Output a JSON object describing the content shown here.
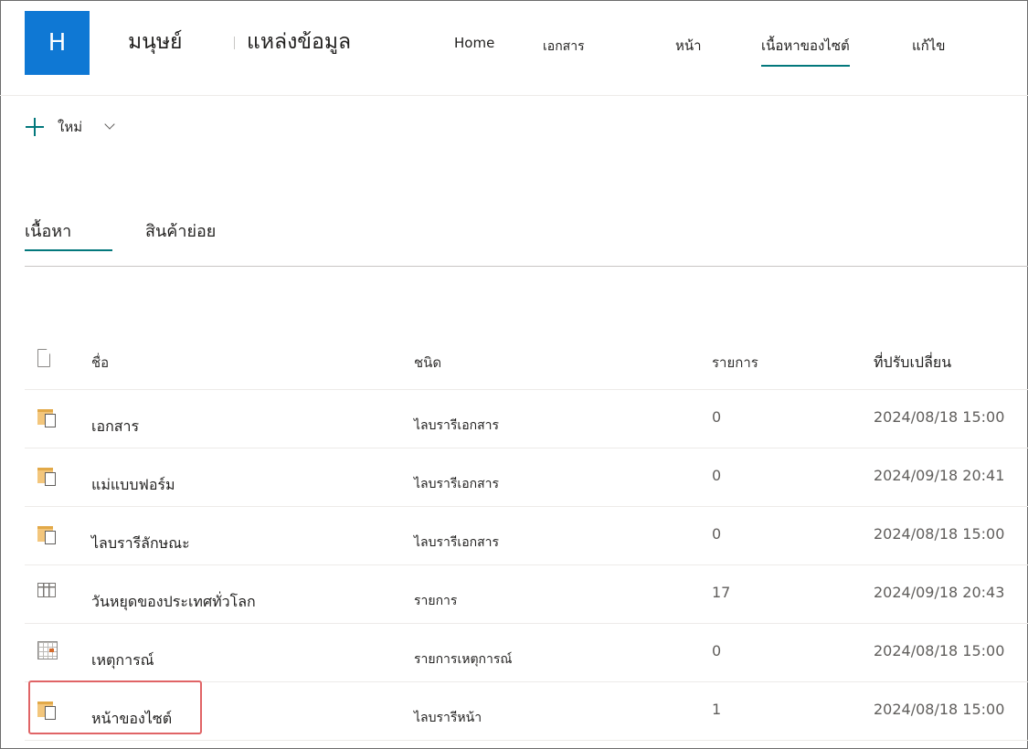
{
  "header": {
    "logo_letter": "H",
    "site_name": "มนุษย์",
    "site_subtitle": "แหล่งข้อมูล",
    "nav": [
      {
        "label": "Home",
        "active": false
      },
      {
        "label": "เอกสาร",
        "active": false
      },
      {
        "label": "หน้า",
        "active": false
      },
      {
        "label": "เนื้อหาของไซต์",
        "active": true
      },
      {
        "label": "แก้ไข",
        "active": false
      }
    ]
  },
  "command_bar": {
    "new_label": "ใหม่"
  },
  "tabs": [
    {
      "label": "เนื้อหา",
      "active": true
    },
    {
      "label": "สินค้าย่อย",
      "active": false
    }
  ],
  "table": {
    "columns": {
      "name": "ชื่อ",
      "type": "ชนิด",
      "items": "รายการ",
      "modified": "ที่ปรับเปลี่ยน"
    },
    "rows": [
      {
        "icon": "library-icon",
        "name": "เอกสาร",
        "type": "ไลบรารีเอกสาร",
        "items": "0",
        "modified": "2024/08/18 15:00"
      },
      {
        "icon": "library-icon",
        "name": "แม่แบบฟอร์ม",
        "type": "ไลบรารีเอกสาร",
        "items": "0",
        "modified": "2024/09/18 20:41"
      },
      {
        "icon": "library-icon",
        "name": "ไลบรารีลักษณะ",
        "type": "ไลบรารีเอกสาร",
        "items": "0",
        "modified": "2024/08/18 15:00"
      },
      {
        "icon": "list-icon",
        "name": "วันหยุดของประเทศทั่วโลก",
        "type": "รายการ",
        "items": "17",
        "modified": "2024/09/18 20:43"
      },
      {
        "icon": "calendar-icon",
        "name": "เหตุการณ์",
        "type": "รายการเหตุการณ์",
        "items": "0",
        "modified": "2024/08/18 15:00"
      },
      {
        "icon": "library-icon",
        "name": "หน้าของไซต์",
        "type": "ไลบรารีหน้า",
        "items": "1",
        "modified": "2024/08/18 15:00"
      }
    ]
  },
  "colors": {
    "brand": "#0f78d4",
    "accent": "#03787c",
    "highlight": "#e06466"
  }
}
